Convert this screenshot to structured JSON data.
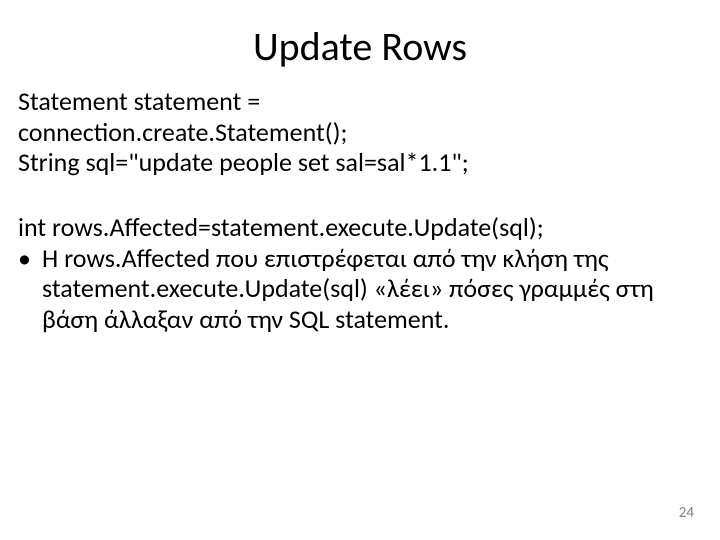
{
  "title": "Update Rows",
  "lines": {
    "l1": "Statement statement =",
    "l2": "connection.create.Statement();",
    "l3": "String sql=\"update people set sal=sal*1.1\";",
    "l4": "int rows.Affected=statement.execute.Update(sql);",
    "bullet_mark": "•",
    "bullet": "Η rows.Affected που επιστρέφεται από την κλήση της statement.execute.Update(sql) «λέει» πόσες γραμμές στη βάση άλλαξαν από την SQL statement."
  },
  "page_number": "24"
}
